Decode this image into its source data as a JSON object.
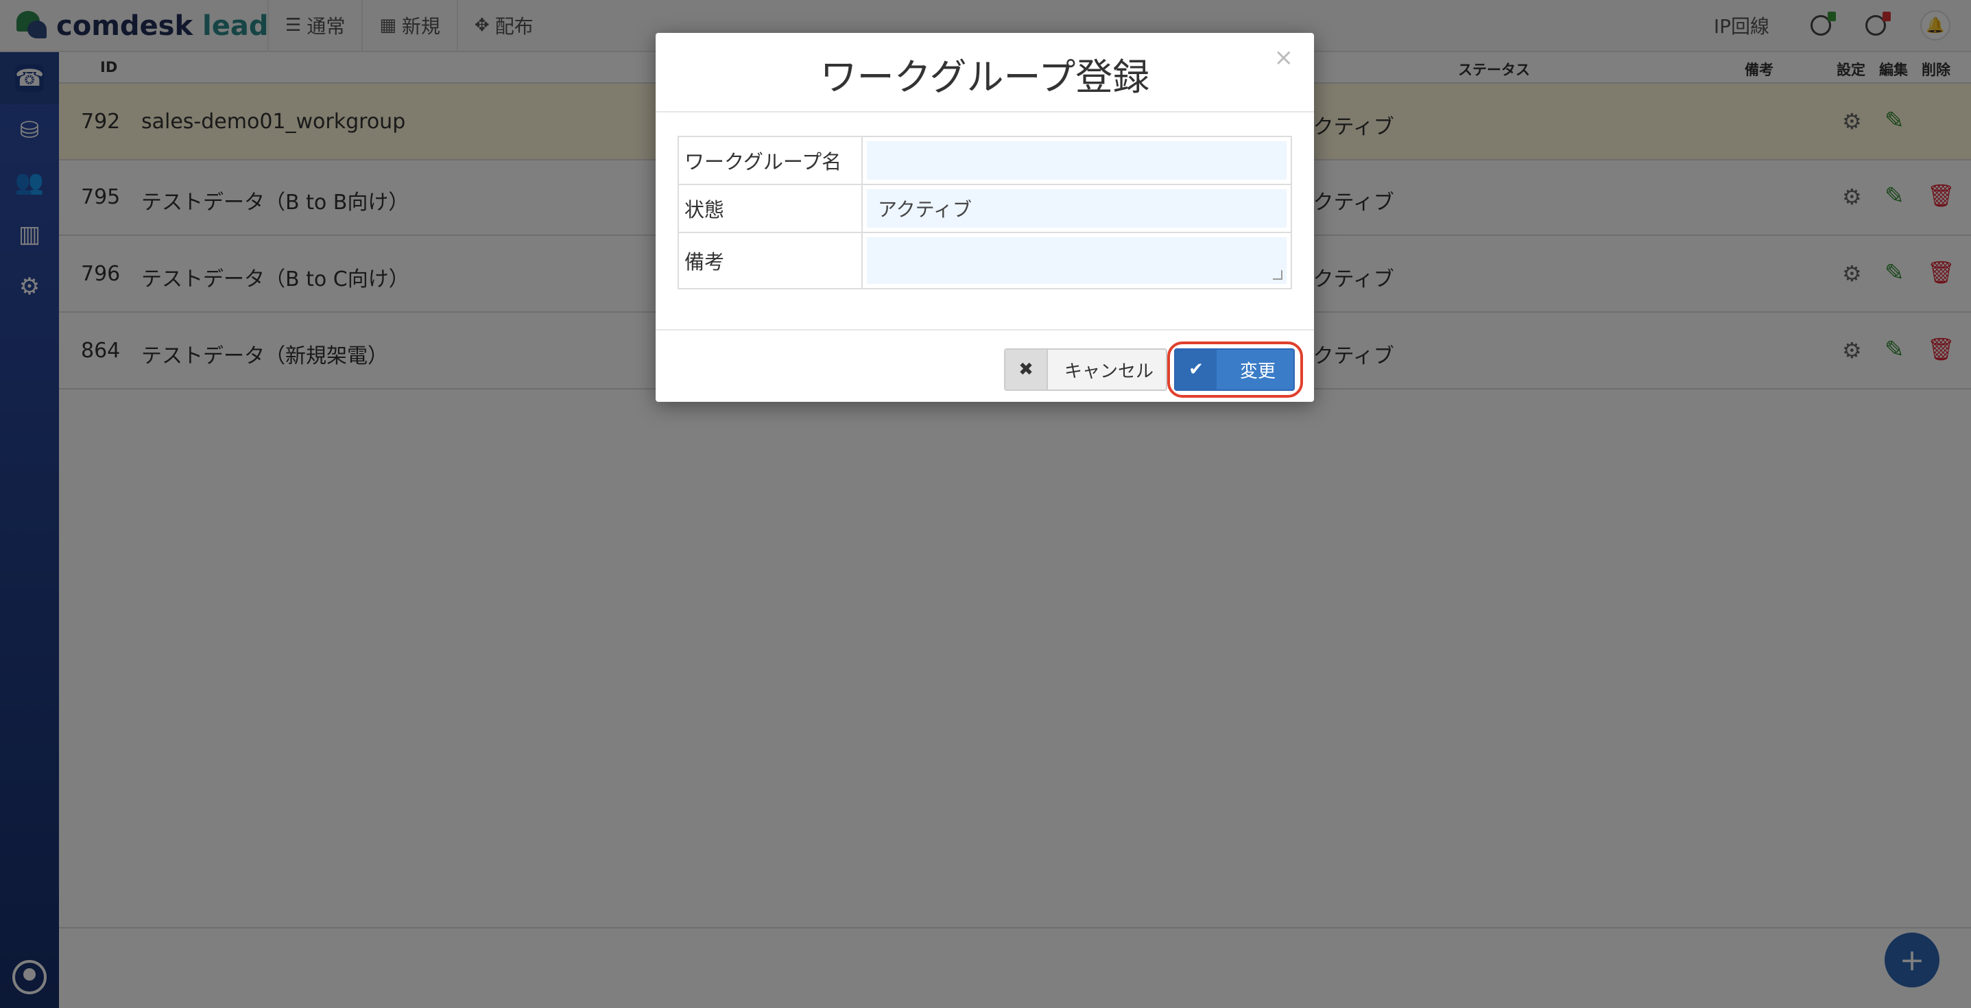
{
  "app": {
    "logo_main": "comdesk",
    "logo_accent": "lead"
  },
  "topnav": [
    {
      "icon": "list-icon",
      "label": "通常"
    },
    {
      "icon": "grid-icon",
      "label": "新規"
    },
    {
      "icon": "expand-icon",
      "label": "配布"
    }
  ],
  "header_right": {
    "ip_line": "IP回線"
  },
  "sidebar": [
    "phone-icon",
    "database-icon",
    "users-icon",
    "chart-icon",
    "gear-icon"
  ],
  "table": {
    "columns": {
      "id": "ID",
      "status": "ステータス",
      "note": "備考",
      "settings": "設定",
      "edit": "編集",
      "delete": "削除"
    },
    "rows": [
      {
        "id": "792",
        "name": "sales-demo01_workgroup",
        "status": "アクティブ"
      },
      {
        "id": "795",
        "name": "テストデータ（B to B向け）",
        "status": "アクティブ"
      },
      {
        "id": "796",
        "name": "テストデータ（B to C向け）",
        "status": "アクティブ"
      },
      {
        "id": "864",
        "name": "テストデータ（新規架電）",
        "status": "アクティブ"
      }
    ]
  },
  "modal": {
    "title": "ワークグループ登録",
    "close": "×",
    "fields": {
      "name_label": "ワークグループ名",
      "name_value": "",
      "status_label": "状態",
      "status_value": "アクティブ",
      "note_label": "備考",
      "note_value": ""
    },
    "cancel_icon": "✖",
    "cancel_label": "キャンセル",
    "ok_icon": "✔",
    "ok_label": "変更"
  },
  "fab_label": "+"
}
